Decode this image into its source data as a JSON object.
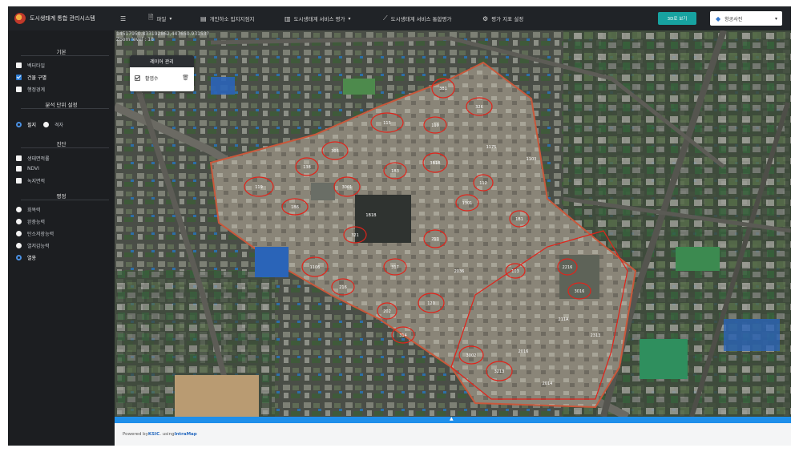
{
  "app": {
    "title": "도시생태계 통합 관리시스템"
  },
  "menu": {
    "hamburger_icon": "menu-icon",
    "items": [
      {
        "label": "파일",
        "icon": "file-icon",
        "dropdown": true
      },
      {
        "label": "개인하소 입지지점지",
        "icon": "table-icon",
        "dropdown": false
      },
      {
        "label": "도시생태계 서비스 평가",
        "icon": "chart-icon",
        "dropdown": true
      },
      {
        "label": "도시생태계 서비스 통합평가",
        "icon": "chart-line-icon",
        "dropdown": false
      },
      {
        "label": "평가 지표 설정",
        "icon": "gear-icon",
        "dropdown": false
      }
    ]
  },
  "toolbar": {
    "view3d_label": "3D로 보기",
    "basemap_selected": "항공사진"
  },
  "sidebar": {
    "basic": {
      "title": "기본",
      "items": [
        {
          "label": "벡터타일",
          "checked": false
        },
        {
          "label": "건물 구별",
          "checked": true
        },
        {
          "label": "행정경계",
          "checked": false
        }
      ]
    },
    "unit": {
      "title": "분석 단위 설정",
      "options": [
        {
          "label": "필지",
          "selected": true
        },
        {
          "label": "격자",
          "selected": false
        }
      ]
    },
    "diagnosis": {
      "title": "진단",
      "items": [
        {
          "label": "생태면적률",
          "checked": false
        },
        {
          "label": "NDVI",
          "checked": false
        },
        {
          "label": "녹지면적",
          "checked": false
        }
      ]
    },
    "evaluation": {
      "title": "평정",
      "options": [
        {
          "label": "회복력",
          "selected": false
        },
        {
          "label": "완충능력",
          "selected": false
        },
        {
          "label": "탄소저장능력",
          "selected": false
        },
        {
          "label": "열저감능력",
          "selected": false
        },
        {
          "label": "열용",
          "selected": true
        }
      ]
    }
  },
  "map": {
    "coords_line1": "14517950.833192862,447650.93153?",
    "coords_line2": "Zoom level : 18",
    "layer_panel": {
      "title": "레이어 관리",
      "layer_label": "활엽수",
      "checked": true
    },
    "parcel_labels": [
      "3B1",
      "326",
      "110",
      "115",
      "303",
      "138",
      "119",
      "1B6",
      "3001",
      "1B3",
      "3B1B",
      "112",
      "1301",
      "1B1",
      "321",
      "211",
      "1106",
      "216",
      "317",
      "120",
      "202",
      "314",
      "3002",
      "3213",
      "2216",
      "3016",
      "103",
      "1175",
      "1103",
      "2036",
      "1B1B",
      "211A",
      "2313",
      "2014",
      "2016"
    ]
  },
  "footer": {
    "prefix": "Powered by ",
    "org": "KSIC",
    "mid": ". using ",
    "product": "IntraMap"
  },
  "colors": {
    "accent": "#17a2a0",
    "strip": "#1e8fea",
    "parcel_outline": "#e2231a",
    "sidebar_bg": "#1c1e21"
  }
}
